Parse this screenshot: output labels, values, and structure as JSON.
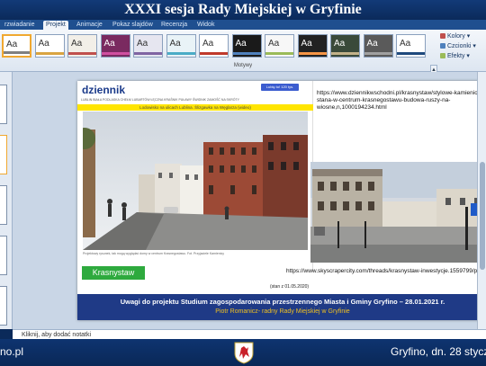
{
  "broadcast": {
    "title": "XXXI sesja Rady Miejskiej w Gryfinie",
    "bottom_left": "no.pl",
    "bottom_right": "Gryfino, dn. 28 styczn"
  },
  "ribbon": {
    "tabs": [
      "rzwiadanie",
      "Projekt",
      "Animacje",
      "Pokaz slajdów",
      "Recenzja",
      "Widok"
    ],
    "active_tab": "Projekt",
    "group_label": "Motywy",
    "themes": [
      {
        "bg": "#ffffff",
        "stripe": "#7f7f7f",
        "aa": "#333333"
      },
      {
        "bg": "#ffffff",
        "stripe": "#d9a441",
        "aa": "#333333"
      },
      {
        "bg": "#f2efe8",
        "stripe": "#c0504d",
        "aa": "#333333"
      },
      {
        "bg": "#7a2a60",
        "stripe": "#d04fa0",
        "aa": "#ffffff"
      },
      {
        "bg": "#e6e6f0",
        "stripe": "#8064a2",
        "aa": "#333333"
      },
      {
        "bg": "#e9f3f7",
        "stripe": "#4bacc6",
        "aa": "#333333"
      },
      {
        "bg": "#ffffff",
        "stripe": "#c0392b",
        "aa": "#333333"
      },
      {
        "bg": "#1a1a1a",
        "stripe": "#4f81bd",
        "aa": "#ffffff"
      },
      {
        "bg": "#f7f7f7",
        "stripe": "#9bbb59",
        "aa": "#333333"
      },
      {
        "bg": "#222222",
        "stripe": "#f79646",
        "aa": "#ffffff"
      },
      {
        "bg": "#3a4a3a",
        "stripe": "#c3b28a",
        "aa": "#ffffff"
      },
      {
        "bg": "#5a5a5a",
        "stripe": "#a0a0a0",
        "aa": "#ffffff"
      },
      {
        "bg": "#ffffff",
        "stripe": "#1f497d",
        "aa": "#333333"
      }
    ],
    "options": [
      {
        "label": "Kolory",
        "color": "#c0504d"
      },
      {
        "label": "Czcionki",
        "color": "#4f81bd"
      },
      {
        "label": "Efekty",
        "color": "#9bbb59"
      }
    ]
  },
  "slide": {
    "news": {
      "logo": "dziennik",
      "fb": "Lubię to! 120 tys.",
      "nav": "LUBLIN  BIAŁA PODLASKA  CHEŁM  LUBARTÓW  ŁĘCZNA  KRAŚNIK  PUŁAWY  ŚWIDNIK  ZAMOŚĆ  NA SKRÓTY",
      "banner": "Lodowisko na ulicach Lublina. Ślizgawka na Węglarza (wideo)",
      "caption": "Projektowy rysunek, tak mogą wyglądać domy w centrum Krasnegostawu. Fot. Przyjaciele Kamienicy"
    },
    "url1": "https://www.dziennikwschodni.pl/krasnystaw/stylowe-kamienice-stana-w-centrum-krasnegostawu-budowa-ruszy-na-wiosne,n,1000194234.html",
    "tag": "Krasnystaw",
    "url2": "https://www.skyscrapercity.com/threads/krasnystaw-inwestycje.1559799/pag",
    "stan": "(stan z 01.05.2020)",
    "footer_title": "Uwagi do projektu Studium zagospodarowania  przestrzennego Miasta i Gminy Gryfino – 28.01.2021 r.",
    "footer_author": "Piotr Romanicz- radny Rady Miejskiej w Gryfinie"
  },
  "notes": {
    "placeholder": "Kliknij, aby dodać notatki"
  }
}
